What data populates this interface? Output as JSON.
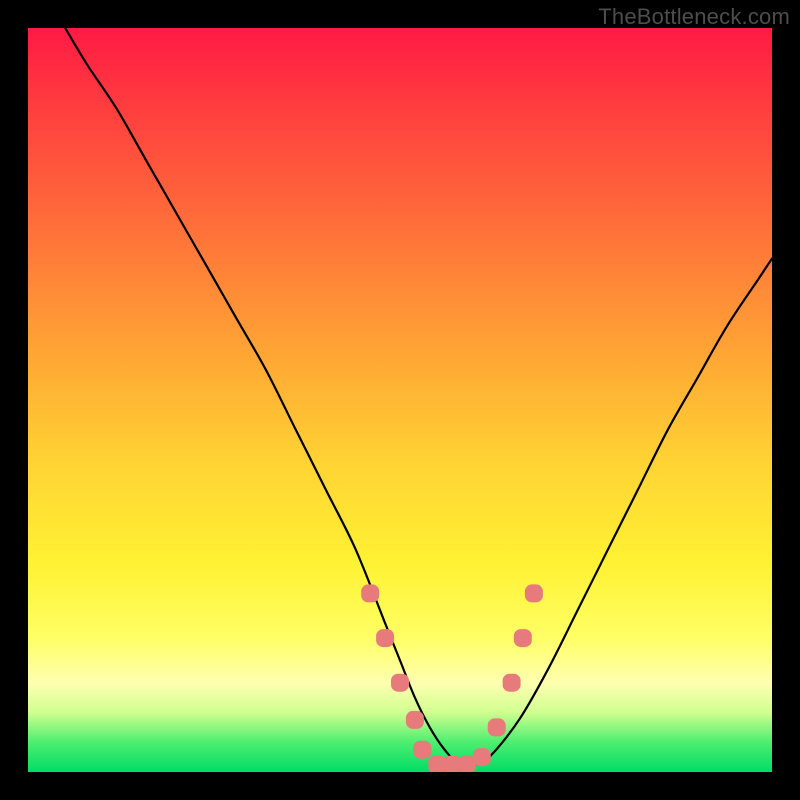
{
  "watermark": "TheBottleneck.com",
  "colors": {
    "page_bg": "#000000",
    "curve": "#000000",
    "marker_fill": "#e77a7a",
    "marker_stroke": "#d95f5f"
  },
  "chart_data": {
    "type": "line",
    "title": "",
    "xlabel": "",
    "ylabel": "",
    "xlim": [
      0,
      100
    ],
    "ylim": [
      0,
      100
    ],
    "grid": false,
    "legend": false,
    "annotations": [
      "TheBottleneck.com"
    ],
    "series": [
      {
        "name": "bottleneck-curve",
        "x": [
          5,
          8,
          12,
          16,
          20,
          24,
          28,
          32,
          36,
          40,
          44,
          48,
          50,
          52,
          54,
          56,
          58,
          60,
          62,
          66,
          70,
          74,
          78,
          82,
          86,
          90,
          94,
          98,
          100
        ],
        "y": [
          100,
          95,
          89,
          82,
          75,
          68,
          61,
          54,
          46,
          38,
          30,
          20,
          15,
          10,
          6,
          3,
          1,
          1,
          2,
          7,
          14,
          22,
          30,
          38,
          46,
          53,
          60,
          66,
          69
        ]
      }
    ],
    "markers": [
      {
        "x": 46,
        "y": 24
      },
      {
        "x": 48,
        "y": 18
      },
      {
        "x": 50,
        "y": 12
      },
      {
        "x": 52,
        "y": 7
      },
      {
        "x": 53,
        "y": 3
      },
      {
        "x": 55,
        "y": 1
      },
      {
        "x": 57,
        "y": 1
      },
      {
        "x": 59,
        "y": 1
      },
      {
        "x": 61,
        "y": 2
      },
      {
        "x": 63,
        "y": 6
      },
      {
        "x": 65,
        "y": 12
      },
      {
        "x": 66.5,
        "y": 18
      },
      {
        "x": 68,
        "y": 24
      }
    ],
    "notes": "Values are read off a chart with no explicit axes; x and y are estimated on a 0–100 scale relative to the plot area. y=0 corresponds to the bottom (green) edge, y=100 to the top (red) edge."
  }
}
